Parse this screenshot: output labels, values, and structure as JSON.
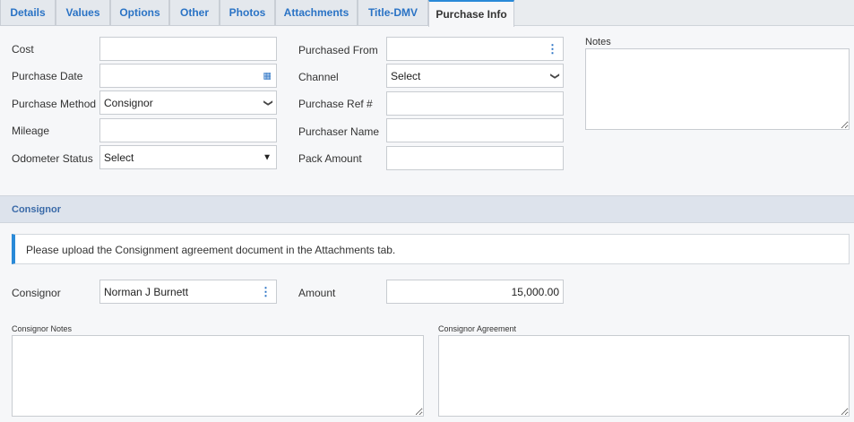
{
  "tabs": [
    "Details",
    "Values",
    "Options",
    "Other",
    "Photos",
    "Attachments",
    "Title-DMV",
    "Purchase Info"
  ],
  "form": {
    "cost_label": "Cost",
    "purchase_date_label": "Purchase Date",
    "purchase_method_label": "Purchase Method",
    "purchase_method_value": "Consignor",
    "mileage_label": "Mileage",
    "odometer_label": "Odometer Status",
    "odometer_value": "Select",
    "purchased_from_label": "Purchased From",
    "channel_label": "Channel",
    "channel_value": "Select",
    "ref_label": "Purchase Ref #",
    "purchaser_label": "Purchaser Name",
    "pack_label": "Pack Amount",
    "notes_label": "Notes"
  },
  "consignor": {
    "title": "Consignor",
    "info": "Please upload the Consignment agreement document in the Attachments tab.",
    "consignor_label": "Consignor",
    "consignor_value": "Norman J Burnett",
    "amount_label": "Amount",
    "amount_value": "15,000.00",
    "notes_label": "Consignor Notes",
    "agreement_label": "Consignor Agreement"
  }
}
